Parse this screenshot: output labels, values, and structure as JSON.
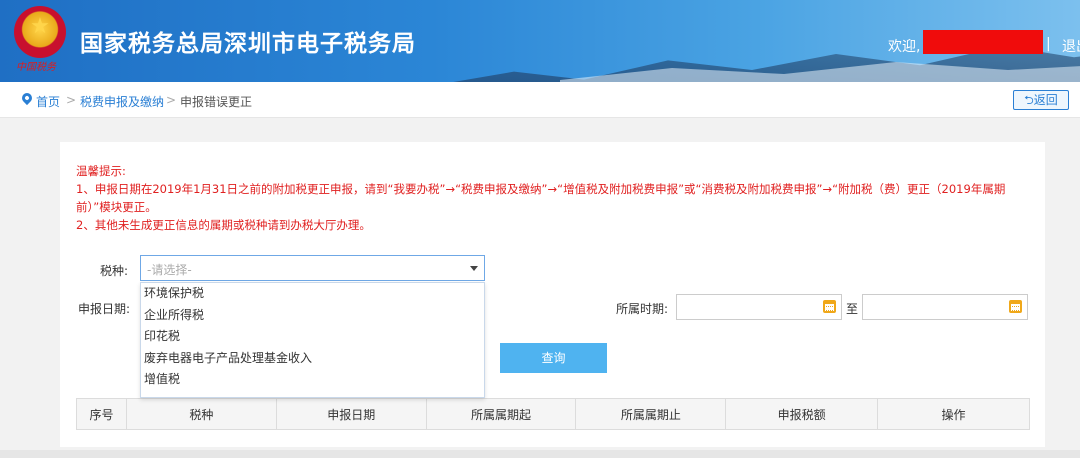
{
  "header": {
    "title": "国家税务总局深圳市电子税务局",
    "emblem_text": "中国税务",
    "welcome": "欢迎,",
    "divider": "|",
    "logout": "退出"
  },
  "breadcrumb": {
    "home": "首页",
    "separator": ">",
    "section": "税费申报及缴纳",
    "current": "申报错误更正",
    "back_label": "返回"
  },
  "tips": {
    "title": "温馨提示:",
    "line1": "1、申报日期在2019年1月31日之前的附加税更正申报，请到“我要办税”→“税费申报及缴纳”→“增值税及附加税费申报”或“消费税及附加税费申报”→“附加税（费）更正（2019年属期前）”模块更正。",
    "line2": "2、其他未生成更正信息的属期或税种请到办税大厅办理。"
  },
  "form": {
    "tax_label": "税种:",
    "tax_placeholder": "-请选择-",
    "date_label": "申报日期:",
    "period_label": "所属时期:",
    "to_label": "至",
    "query_label": "查询"
  },
  "dropdown": {
    "options": [
      "环境保护税",
      "企业所得税",
      "印花税",
      "废弃电器电子产品处理基金收入",
      "增值税"
    ]
  },
  "table": {
    "headers": [
      "序号",
      "税种",
      "申报日期",
      "所属属期起",
      "所属属期止",
      "申报税额",
      "操作"
    ]
  },
  "colors": {
    "accent": "#2a7fd4",
    "tip_red": "#e02020",
    "query_button": "#4fb3f0",
    "mask_red": "#f00c0c"
  }
}
